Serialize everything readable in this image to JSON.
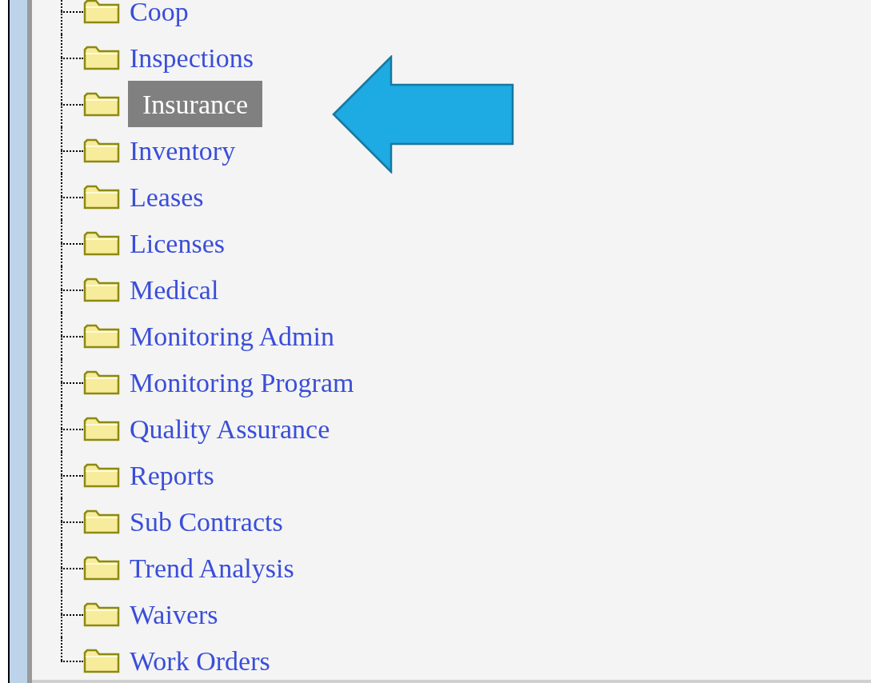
{
  "tree": {
    "items": [
      {
        "label": "Coop",
        "selected": false
      },
      {
        "label": "Inspections",
        "selected": false
      },
      {
        "label": "Insurance",
        "selected": true
      },
      {
        "label": "Inventory",
        "selected": false
      },
      {
        "label": "Leases",
        "selected": false
      },
      {
        "label": "Licenses",
        "selected": false
      },
      {
        "label": "Medical",
        "selected": false
      },
      {
        "label": "Monitoring Admin",
        "selected": false
      },
      {
        "label": "Monitoring Program",
        "selected": false
      },
      {
        "label": "Quality Assurance",
        "selected": false
      },
      {
        "label": "Reports",
        "selected": false
      },
      {
        "label": "Sub Contracts",
        "selected": false
      },
      {
        "label": "Trend Analysis",
        "selected": false
      },
      {
        "label": "Waivers",
        "selected": false
      },
      {
        "label": "Work Orders",
        "selected": false
      }
    ]
  }
}
